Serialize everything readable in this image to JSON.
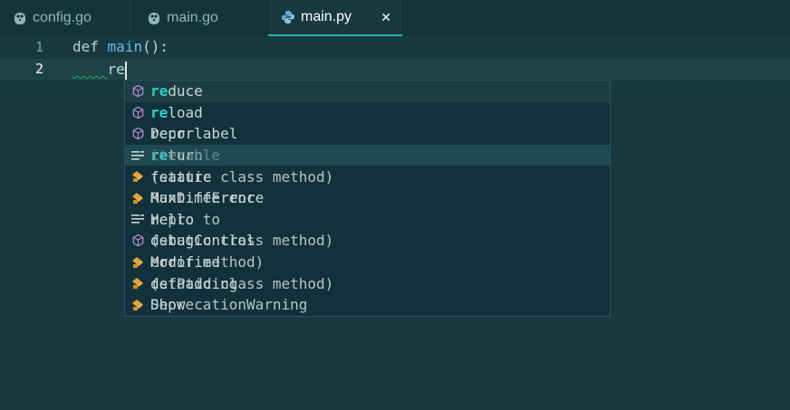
{
  "tabs": [
    {
      "label": "config.go",
      "icon": "gopher-icon",
      "active": false
    },
    {
      "label": "main.go",
      "icon": "gopher-icon",
      "active": false
    },
    {
      "label": "main.py",
      "icon": "python-icon",
      "active": true,
      "close": "✕"
    }
  ],
  "editor": {
    "lines": [
      {
        "num": "1",
        "kw": "def",
        "fn": "main",
        "rest": "():"
      },
      {
        "num": "2",
        "indent": "    ",
        "typed": "re"
      }
    ]
  },
  "suggest": {
    "match_prefix": "re",
    "items": [
      {
        "icon": "module-icon",
        "prefix": "re",
        "rest": "duce",
        "overlay": ""
      },
      {
        "icon": "module-icon",
        "prefix": "re",
        "rest": "load",
        "overlay": ""
      },
      {
        "icon": "module-icon",
        "prefix": "",
        "rest": "Decorlabel",
        "overlay": "repr"
      },
      {
        "icon": "keyword-icon",
        "prefix": "re",
        "rest": "turn",
        "overlay": "iterable"
      },
      {
        "icon": "class-icon",
        "prefix": "",
        "rest": "feature",
        "overlay": "(static class method)"
      },
      {
        "icon": "class-icon",
        "prefix": "",
        "rest": "MaxDifference",
        "overlay": "RuntimeError"
      },
      {
        "icon": "keyword-icon",
        "prefix": "",
        "rest": "Hello",
        "overlay": "repro to"
      },
      {
        "icon": "module-icon",
        "prefix": "",
        "rest": "debugControl",
        "overlay": "(static class method)"
      },
      {
        "icon": "class-icon",
        "prefix": "",
        "rest": "Modified",
        "overlay": "error method)"
      },
      {
        "icon": "class-icon",
        "prefix": "",
        "rest": "defPadding",
        "overlay": "(static class method)"
      },
      {
        "icon": "class-icon",
        "prefix": "",
        "rest": "Show",
        "overlay": "DeprecationWarning"
      }
    ]
  },
  "colors": {
    "background": "#17393f",
    "accent": "#2cb0a1",
    "match": "#2fd0c8"
  }
}
